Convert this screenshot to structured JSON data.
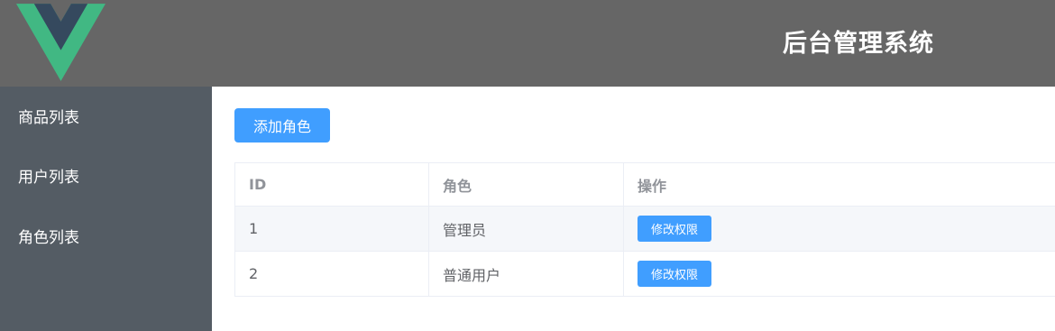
{
  "header": {
    "title": "后台管理系统",
    "logo_icon": "vue-logo-icon",
    "colors": {
      "background": "#666666",
      "logo_outer": "#41b883",
      "logo_inner": "#35495e"
    }
  },
  "sidebar": {
    "background": "#545c64",
    "items": [
      {
        "label": "商品列表"
      },
      {
        "label": "用户列表"
      },
      {
        "label": "角色列表"
      }
    ]
  },
  "main": {
    "add_button_label": "添加角色",
    "table": {
      "headers": [
        "ID",
        "角色",
        "操作"
      ],
      "rows": [
        {
          "id": "1",
          "role": "管理员",
          "action_label": "修改权限"
        },
        {
          "id": "2",
          "role": "普通用户",
          "action_label": "修改权限"
        }
      ]
    },
    "accent_color": "#409eff"
  }
}
